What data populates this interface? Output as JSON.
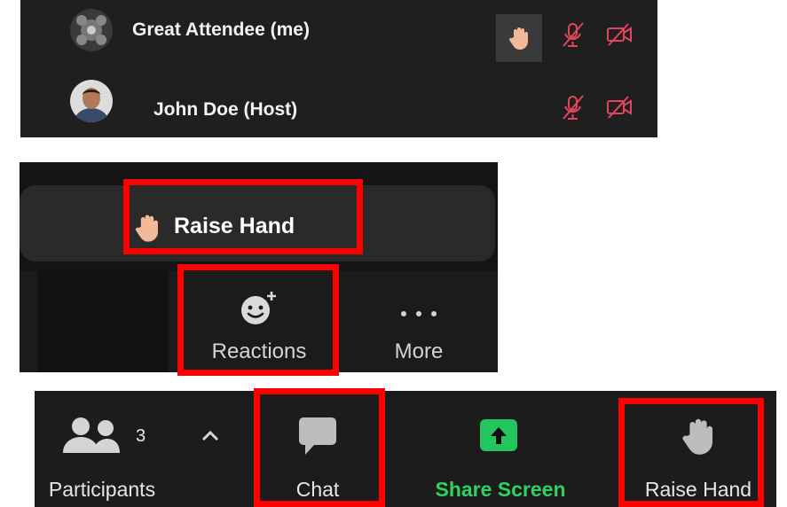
{
  "participants": {
    "rows": [
      {
        "name": "Great Attendee (me)",
        "hand_raised": true,
        "muted": true,
        "video_off": true
      },
      {
        "name": "John Doe (Host)",
        "hand_raised": false,
        "muted": true,
        "video_off": true
      }
    ]
  },
  "reactions_panel": {
    "raise_hand_label": "Raise Hand",
    "reactions_label": "Reactions",
    "more_label": "More"
  },
  "toolbar": {
    "participants_label": "Participants",
    "participants_count": "3",
    "chat_label": "Chat",
    "share_screen_label": "Share Screen",
    "raise_hand_label": "Raise Hand"
  },
  "colors": {
    "highlight_red": "#ff0000",
    "muted_icon_red": "#e0455a",
    "share_green": "#22c55e",
    "hand_skin": "#f2b99a"
  }
}
